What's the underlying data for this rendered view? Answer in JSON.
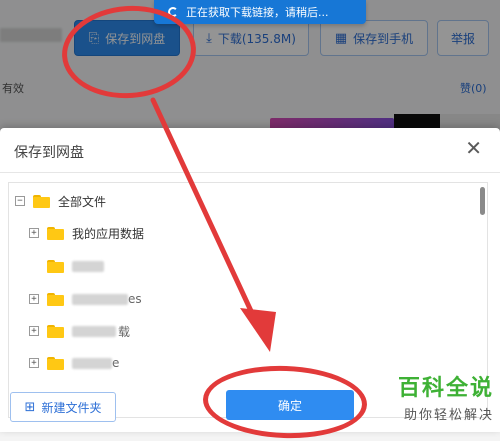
{
  "toolbar": {
    "save_to_cloud": "保存到网盘",
    "download": "下载(135.8M)",
    "save_to_phone": "保存到手机",
    "report": "举报"
  },
  "background": {
    "valid_text": "有效",
    "like_text": "赞(0)",
    "toast_text": "正在获取下载链接，请稍后..."
  },
  "dialog": {
    "title": "保存到网盘",
    "close_symbol": "✕",
    "tree": {
      "root": {
        "label": "全部文件",
        "toggle": "−"
      },
      "items": [
        {
          "label": "我的应用数据",
          "toggle": "+",
          "blurred": false
        },
        {
          "label": "",
          "toggle": "",
          "blurred": true
        },
        {
          "label": "es",
          "toggle": "+",
          "blurred": true
        },
        {
          "label": "载",
          "toggle": "+",
          "blurred": true
        },
        {
          "label": "e",
          "toggle": "+",
          "blurred": true
        }
      ]
    },
    "new_folder_label": "新建文件夹",
    "confirm_label": "确定"
  },
  "watermark": {
    "main": "百科全说",
    "sub": "助你轻松解决"
  },
  "colors": {
    "primary": "#2d8cf0",
    "annotation": "#e23a3a",
    "folder": "#ffc814",
    "watermark_green": "#3eb135"
  }
}
